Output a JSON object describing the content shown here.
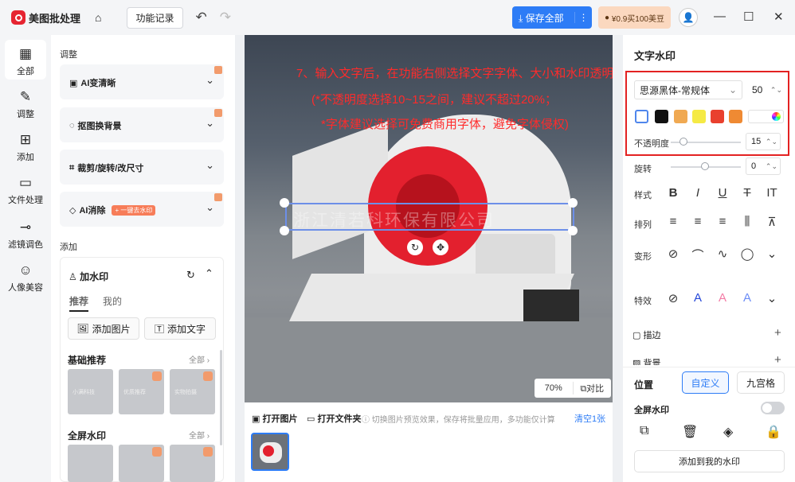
{
  "app": {
    "title": "美图批处理",
    "history": "功能记录",
    "save": "保存全部",
    "promo": "¥0.9买100美豆"
  },
  "nav": [
    {
      "label": "全部",
      "icon": "grid-icon"
    },
    {
      "label": "调整",
      "icon": "edit-icon"
    },
    {
      "label": "添加",
      "icon": "add-icon"
    },
    {
      "label": "文件处理",
      "icon": "folder-icon"
    },
    {
      "label": "滤镜调色",
      "icon": "slider-icon"
    },
    {
      "label": "人像美容",
      "icon": "face-icon"
    }
  ],
  "tools": {
    "section_adjust": "调整",
    "items": [
      "AI变清晰",
      "抠图换背景",
      "裁剪/旋转/改尺寸",
      "AI消除"
    ],
    "ai_tag": "+ 一键去水印",
    "section_add": "添加",
    "watermark": {
      "title": "加水印",
      "tabs": [
        "推荐",
        "我的"
      ],
      "add_image": "添加图片",
      "add_text": "添加文字",
      "basic": "基础推荐",
      "fullscreen": "全屏水印",
      "all": "全部",
      "thumb_text": [
        "小满科技",
        "优质推荐",
        "实物拍摄"
      ]
    }
  },
  "canvas": {
    "annotation": [
      "7、输入文字后，在功能右侧选择文字字体、大小和水印透明度",
      "(*不透明度选择10~15之间，建议不超过20%；",
      "*字体建议选择可免费商用字体，避免字体侵权)"
    ],
    "watermark_text": "浙江清若科环保有限公司",
    "zoom": "70%",
    "compare": "对比"
  },
  "strip": {
    "open_image": "打开图片",
    "open_folder": "打开文件夹",
    "hint": "切换图片预览效果，保存将批量应用，多功能仅计算",
    "clear": "清空1张"
  },
  "right": {
    "title": "文字水印",
    "font": "思源黑体-常规体",
    "size": "50",
    "opacity_label": "不透明度",
    "opacity": "15",
    "rotate_label": "旋转",
    "rotate": "0",
    "style_label": "样式",
    "style": [
      "B",
      "I",
      "U",
      "T",
      "IT"
    ],
    "align_label": "排列",
    "transform_label": "变形",
    "effect_label": "特效",
    "stroke": "描边",
    "bg": "背景",
    "position_label": "位置",
    "pos_custom": "自定义",
    "pos_grid": "九宫格",
    "fullscreen": "全屏水印",
    "add_mine": "添加到我的水印",
    "colors": [
      "#ffffff",
      "#111111",
      "#f0a952",
      "#f5ea45",
      "#e9402e",
      "#ef8a33"
    ]
  }
}
